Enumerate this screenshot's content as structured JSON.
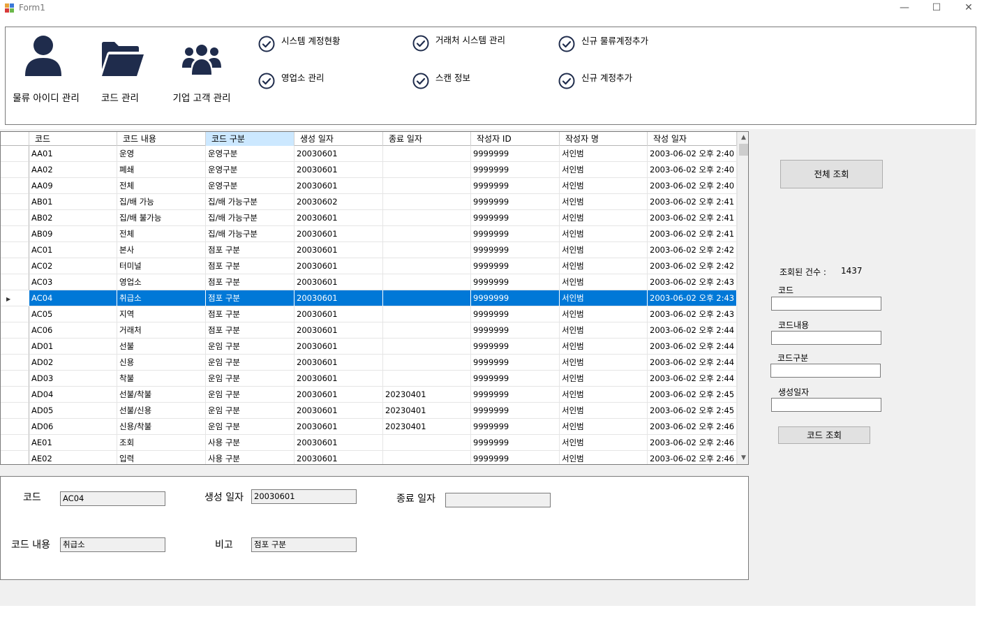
{
  "window": {
    "title": "Form1",
    "minimize": "—",
    "maximize": "☐",
    "close": "✕"
  },
  "menu": {
    "big_buttons": [
      {
        "label": "물류 아이디 관리",
        "icon": "person-icon"
      },
      {
        "label": "코드 관리",
        "icon": "folder-open-icon"
      },
      {
        "label": "기업 고객 관리",
        "icon": "users-group-icon"
      }
    ],
    "check_items": [
      {
        "label": "시스템 계정현황"
      },
      {
        "label": "거래처 시스템 관리"
      },
      {
        "label": "신규 물류계정추가"
      },
      {
        "label": "영업소 관리"
      },
      {
        "label": "스캔 정보"
      },
      {
        "label": "신규 계정추가"
      }
    ]
  },
  "grid": {
    "columns": [
      "코드",
      "코드 내용",
      "코드 구분",
      "생성 일자",
      "종료 일자",
      "작성자 ID",
      "작성자 명",
      "작성 일자"
    ],
    "sorted_column_index": 2,
    "selected_row_index": 9,
    "rows": [
      [
        "AA01",
        "운영",
        "운영구분",
        "20030601",
        "",
        "9999999",
        "서인범",
        "2003-06-02 오후 2:40"
      ],
      [
        "AA02",
        "폐쇄",
        "운영구분",
        "20030601",
        "",
        "9999999",
        "서인범",
        "2003-06-02 오후 2:40"
      ],
      [
        "AA09",
        "전체",
        "운영구분",
        "20030601",
        "",
        "9999999",
        "서인범",
        "2003-06-02 오후 2:40"
      ],
      [
        "AB01",
        "집/배 가능",
        "집/배 가능구분",
        "20030602",
        "",
        "9999999",
        "서인범",
        "2003-06-02 오후 2:41"
      ],
      [
        "AB02",
        "집/배 불가능",
        "집/배 가능구분",
        "20030601",
        "",
        "9999999",
        "서인범",
        "2003-06-02 오후 2:41"
      ],
      [
        "AB09",
        "전체",
        "집/배 가능구분",
        "20030601",
        "",
        "9999999",
        "서인범",
        "2003-06-02 오후 2:41"
      ],
      [
        "AC01",
        "본사",
        "점포 구분",
        "20030601",
        "",
        "9999999",
        "서인범",
        "2003-06-02 오후 2:42"
      ],
      [
        "AC02",
        "터미널",
        "점포 구분",
        "20030601",
        "",
        "9999999",
        "서인범",
        "2003-06-02 오후 2:42"
      ],
      [
        "AC03",
        "영업소",
        "점포 구분",
        "20030601",
        "",
        "9999999",
        "서인범",
        "2003-06-02 오후 2:43"
      ],
      [
        "AC04",
        "취급소",
        "점포 구분",
        "20030601",
        "",
        "9999999",
        "서인범",
        "2003-06-02 오후 2:43"
      ],
      [
        "AC05",
        "지역",
        "점포 구분",
        "20030601",
        "",
        "9999999",
        "서인범",
        "2003-06-02 오후 2:43"
      ],
      [
        "AC06",
        "거래처",
        "점포 구분",
        "20030601",
        "",
        "9999999",
        "서인범",
        "2003-06-02 오후 2:44"
      ],
      [
        "AD01",
        "선불",
        "운임 구분",
        "20030601",
        "",
        "9999999",
        "서인범",
        "2003-06-02 오후 2:44"
      ],
      [
        "AD02",
        "신용",
        "운임 구분",
        "20030601",
        "",
        "9999999",
        "서인범",
        "2003-06-02 오후 2:44"
      ],
      [
        "AD03",
        "착불",
        "운임 구분",
        "20030601",
        "",
        "9999999",
        "서인범",
        "2003-06-02 오후 2:44"
      ],
      [
        "AD04",
        "선불/착불",
        "운임 구분",
        "20030601",
        "20230401",
        "9999999",
        "서인범",
        "2003-06-02 오후 2:45"
      ],
      [
        "AD05",
        "선불/신용",
        "운임 구분",
        "20030601",
        "20230401",
        "9999999",
        "서인범",
        "2003-06-02 오후 2:45"
      ],
      [
        "AD06",
        "신용/착불",
        "운임 구분",
        "20030601",
        "20230401",
        "9999999",
        "서인범",
        "2003-06-02 오후 2:46"
      ],
      [
        "AE01",
        "조회",
        "사용 구분",
        "20030601",
        "",
        "9999999",
        "서인범",
        "2003-06-02 오후 2:46"
      ],
      [
        "AE02",
        "입력",
        "사용 구분",
        "20030601",
        "",
        "9999999",
        "서인범",
        "2003-06-02 오후 2:46"
      ]
    ]
  },
  "side": {
    "all_query_button": "전체 조회",
    "count_label": "조회된 건수 :",
    "count_value": "1437",
    "code_label": "코드",
    "code_value": "",
    "content_label": "코드내용",
    "content_value": "",
    "type_label": "코드구분",
    "type_value": "",
    "created_label": "생성일자",
    "created_value": "",
    "code_query_button": "코드 조회"
  },
  "detail": {
    "code_label": "코드",
    "code_value": "AC04",
    "created_label": "생성 일자",
    "created_value": "20030601",
    "end_label": "종료 일자",
    "end_value": "",
    "content_label": "코드 내용",
    "content_value": "취급소",
    "note_label": "비고",
    "note_value": "점포 구분"
  },
  "colors": {
    "selection": "#0078d7",
    "sorted_header": "#cce8ff",
    "icon_navy": "#1f2c4c"
  }
}
